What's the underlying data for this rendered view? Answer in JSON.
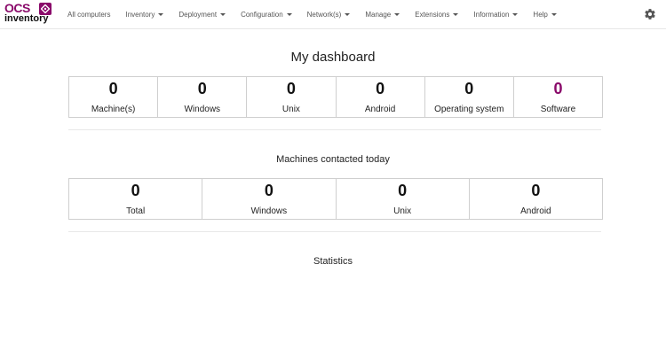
{
  "app": {
    "logo_text_top": "OCS",
    "logo_text_bottom": "inventory"
  },
  "nav": {
    "items": [
      {
        "label": "All computers",
        "dropdown": false
      },
      {
        "label": "Inventory",
        "dropdown": true
      },
      {
        "label": "Deployment",
        "dropdown": true
      },
      {
        "label": "Configuration",
        "dropdown": true
      },
      {
        "label": "Network(s)",
        "dropdown": true
      },
      {
        "label": "Manage",
        "dropdown": true
      },
      {
        "label": "Extensions",
        "dropdown": true
      },
      {
        "label": "Information",
        "dropdown": true
      },
      {
        "label": "Help",
        "dropdown": true
      }
    ],
    "settings_icon": "gear-icon"
  },
  "dashboard": {
    "title": "My dashboard",
    "summary": [
      {
        "value": "0",
        "label": "Machine(s)"
      },
      {
        "value": "0",
        "label": "Windows"
      },
      {
        "value": "0",
        "label": "Unix"
      },
      {
        "value": "0",
        "label": "Android"
      },
      {
        "value": "0",
        "label": "Operating system"
      },
      {
        "value": "0",
        "label": "Software"
      }
    ],
    "contacted_title": "Machines contacted today",
    "contacted": [
      {
        "value": "0",
        "label": "Total"
      },
      {
        "value": "0",
        "label": "Windows"
      },
      {
        "value": "0",
        "label": "Unix"
      },
      {
        "value": "0",
        "label": "Android"
      }
    ],
    "statistics_title": "Statistics"
  },
  "colors": {
    "brand": "#8a0a6a",
    "text": "#222222",
    "border": "#cfcfcf"
  }
}
